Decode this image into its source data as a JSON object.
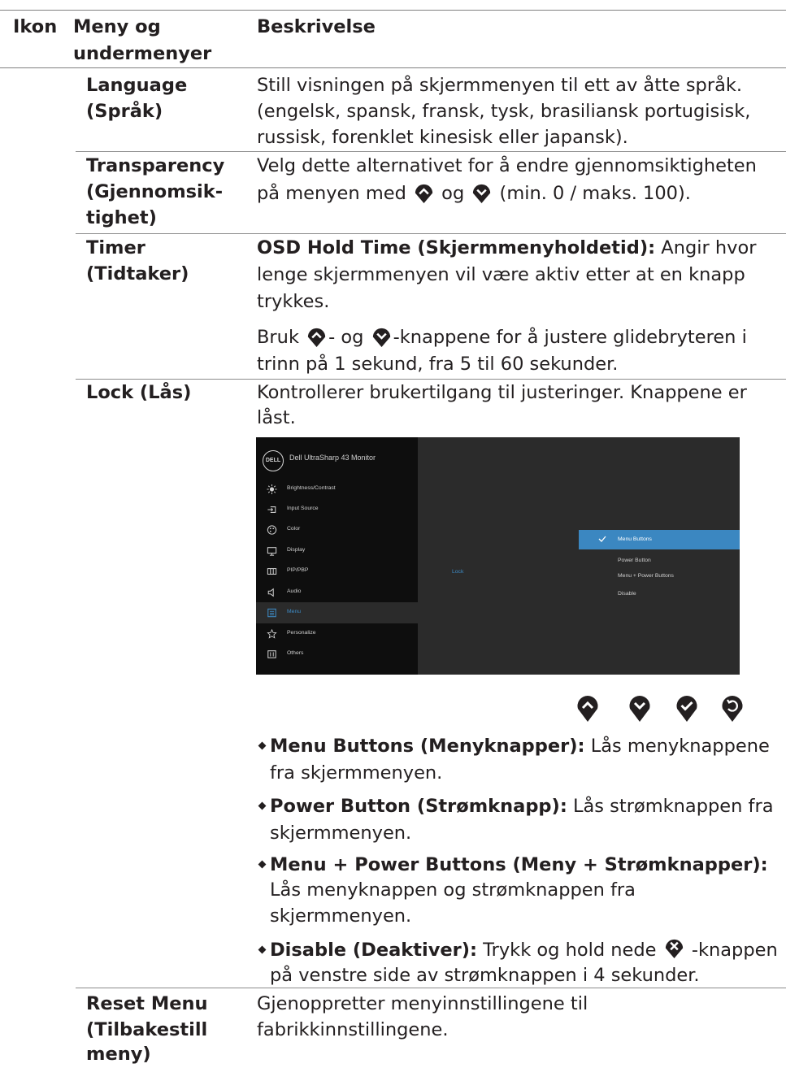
{
  "header": {
    "col_icon": "Ikon",
    "col_menu_line1": "Meny og",
    "col_menu_line2": "undermenyer",
    "col_desc": "Beskrivelse"
  },
  "rows": {
    "language": {
      "menu_line1": "Language",
      "menu_line2": "(Språk)",
      "desc_line1": "Still visningen på skjermmenyen til ett av åtte språk.",
      "desc_line2": "(engelsk, spansk, fransk, tysk, brasiliansk portugisisk,",
      "desc_line3": "russisk, forenklet kinesisk eller japansk)."
    },
    "transparency": {
      "menu_line1": "Transparency",
      "menu_line2": "(Gjennomsik-",
      "menu_line3": "tighet)",
      "desc_line1": "Velg dette alternativet for å endre gjennomsiktigheten",
      "desc_line2_a": "på menyen med",
      "desc_line2_b": "og",
      "desc_line2_c": "(min. 0 / maks. 100)."
    },
    "timer": {
      "menu_line1": "Timer",
      "menu_line2": "(Tidtaker)",
      "desc_bold": "OSD Hold Time (Skjermmenyholdetid):",
      "desc_line1_rest": " Angir hvor",
      "desc_line2": "lenge skjermmenyen vil være aktiv etter at en knapp",
      "desc_line3": "trykkes.",
      "desc2_a": "Bruk",
      "desc2_b": "- og",
      "desc2_c": "-knappene for å justere glidebryteren i",
      "desc2_line2": "trinn på 1 sekund, fra 5 til 60 sekunder."
    },
    "lock": {
      "menu_line1": "Lock (Lås)",
      "desc_line1": "Kontrollerer brukertilgang til justeringer. Knappene er",
      "desc_line2": "låst."
    },
    "reset": {
      "menu_line1": "Reset Menu",
      "menu_line2": "(Tilbakestill",
      "menu_line3": "meny)",
      "desc_line1": "Gjenoppretter menyinnstillingene til",
      "desc_line2": "fabrikkinnstillingene."
    }
  },
  "osd": {
    "logo": "DELL",
    "title": "Dell UltraSharp 43 Monitor",
    "items": [
      {
        "label": "Brightness/Contrast",
        "icon": "sun-icon"
      },
      {
        "label": "Input Source",
        "icon": "input-icon"
      },
      {
        "label": "Color",
        "icon": "palette-icon"
      },
      {
        "label": "Display",
        "icon": "monitor-icon"
      },
      {
        "label": "PIP/PBP",
        "icon": "pip-icon"
      },
      {
        "label": "Audio",
        "icon": "speaker-icon"
      },
      {
        "label": "Menu",
        "icon": "menu-icon"
      },
      {
        "label": "Personalize",
        "icon": "star-icon"
      },
      {
        "label": "Others",
        "icon": "others-icon"
      }
    ],
    "submenu_label": "Lock",
    "options": [
      "Menu Buttons",
      "Power Button",
      "Menu + Power Buttons",
      "Disable"
    ],
    "selected_option": "Menu Buttons",
    "accent_color": "#3b87c1"
  },
  "lock_bullets": [
    {
      "bold": "Menu Buttons (Menyknapper):",
      "line1_rest": " Lås menyknappene",
      "line2": "fra skjermmenyen."
    },
    {
      "bold": "Power Button (Strømknapp):",
      "line1_rest": " Lås strømknappen fra",
      "line2": "skjermmenyen."
    },
    {
      "bold": "Menu + Power Buttons (Meny + Strømknapper):",
      "line2": "Lås menyknappen og strømknappen fra",
      "line3": "skjermmenyen."
    },
    {
      "bold": "Disable (Deaktiver):",
      "line1_a": " Trykk og hold nede",
      "line1_b": " -knappen",
      "line2": "på venstre side av strømknappen i 4 sekunder."
    }
  ]
}
